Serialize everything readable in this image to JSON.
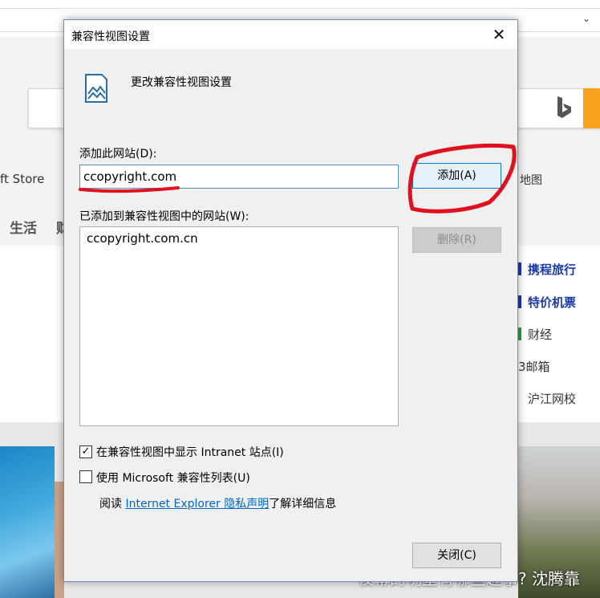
{
  "background": {
    "store_text": "ft Store",
    "map_text": "地图",
    "life_tab": "生活",
    "life_tab2": "财",
    "side_links": [
      {
        "label": "携程旅行",
        "style": "bold",
        "mark_color": "#1a3aa8"
      },
      {
        "label": "特价机票",
        "style": "bold",
        "mark_color": "#1a3aa8"
      },
      {
        "label": "财经",
        "style": "plain",
        "mark_color": "#2f9a4c"
      },
      {
        "label": "3邮箱",
        "style": "plain",
        "mark_color": ""
      },
      {
        "label": "沪江网校",
        "style": "plain",
        "mark_color": ""
      }
    ],
    "photo_caption": "夜幕的明星有哪些趣事? 沈腾靠"
  },
  "dialog": {
    "title": "兼容性视图设置",
    "header": "更改兼容性视图设置",
    "add_label": "添加此网站(D):",
    "add_value": "ccopyright.com",
    "add_button": "添加(A)",
    "list_label": "已添加到兼容性视图中的网站(W):",
    "sites": [
      "ccopyright.com.cn"
    ],
    "remove_button": "删除(R)",
    "intranet_label": "在兼容性视图中显示 Intranet 站点(I)",
    "intranet_checked": "✓",
    "mslist_label": "使用 Microsoft 兼容性列表(U)",
    "read_prefix": "阅读 ",
    "privacy_link": "Internet Explorer 隐私声明",
    "read_suffix": "了解详细信息",
    "close_button": "关闭(C)"
  },
  "colors": {
    "annotation": "#e0101c",
    "accent": "#0078d7",
    "link": "#0066cc"
  }
}
